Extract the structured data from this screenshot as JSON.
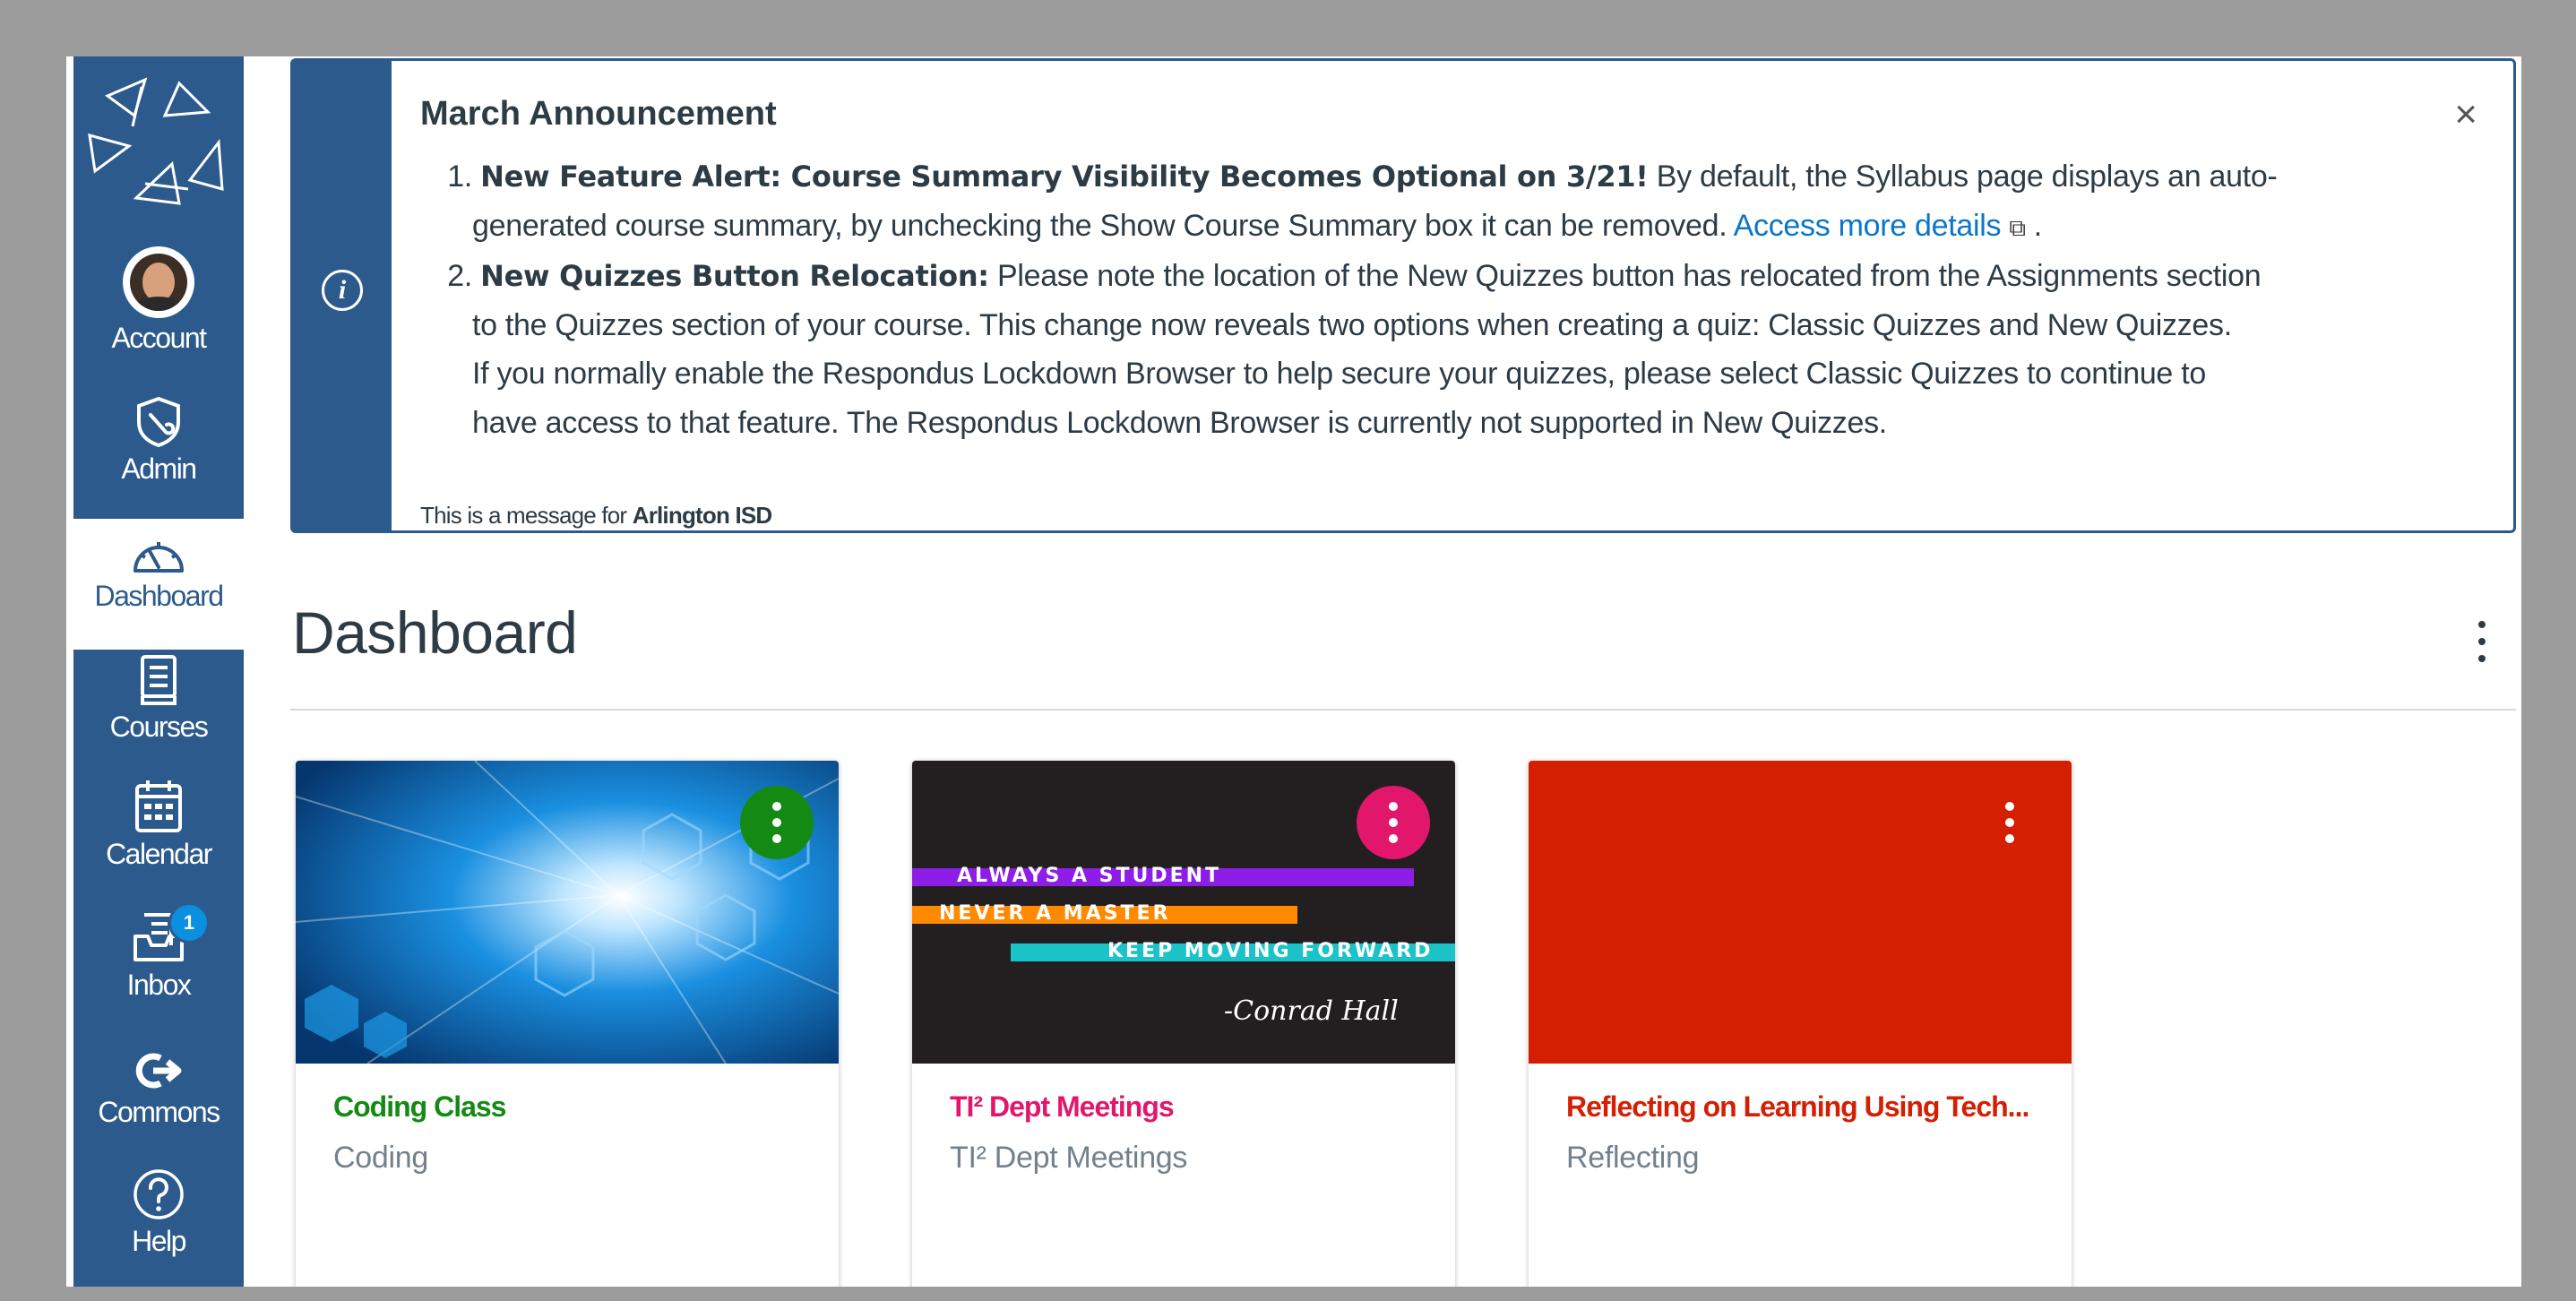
{
  "nav": {
    "items": [
      {
        "label": "Account",
        "icon": "avatar"
      },
      {
        "label": "Admin",
        "icon": "shield-icon"
      },
      {
        "label": "Dashboard",
        "icon": "speedometer-icon",
        "active": true
      },
      {
        "label": "Courses",
        "icon": "book-icon"
      },
      {
        "label": "Calendar",
        "icon": "calendar-icon"
      },
      {
        "label": "Inbox",
        "icon": "inbox-icon",
        "badge": "1"
      },
      {
        "label": "Commons",
        "icon": "commons-arrow-icon"
      },
      {
        "label": "Help",
        "icon": "question-circle-icon"
      }
    ],
    "colors": {
      "background": "#2d5a8c",
      "active_background": "#ffffff"
    }
  },
  "announcement": {
    "title": "March Announcement",
    "close_icon": "×",
    "info_icon": "i",
    "item1_number": "1.",
    "item1_bold": "New Feature Alert: Course Summary Visibility Becomes Optional on 3/21!",
    "item1_text_a": " By default, the Syllabus page displays an auto-",
    "item1_text_b": "generated course summary, by unchecking the Show Course Summary box it can be removed. ",
    "item1_link": "Access more details",
    "item1_link_icon": "⧉",
    "item1_end": " .",
    "item2_number": "2.",
    "item2_bold": "New Quizzes Button Relocation:",
    "item2_text_a": " Please note the location of the New Quizzes button has relocated from the Assignments section",
    "item2_text_b": "to the Quizzes section of your course. This change now reveals two options when creating a quiz: Classic Quizzes and New Quizzes.",
    "item2_text_c": "If you normally enable the Respondus Lockdown Browser to help secure your quizzes, please select Classic Quizzes to continue to",
    "item2_text_d": "have access to that feature. The Respondus Lockdown Browser is currently not supported in New Quizzes.",
    "footer_prefix": "This is a message for ",
    "footer_org": "Arlington ISD"
  },
  "dashboard": {
    "title": "Dashboard",
    "cards": [
      {
        "title": "Coding Class",
        "subtitle": "Coding",
        "color": "#138a13"
      },
      {
        "title": "TI² Dept Meetings",
        "subtitle": "TI² Dept Meetings",
        "color": "#e2176b",
        "hero_lines": [
          "ALWAYS A STUDENT",
          "NEVER A MASTER",
          "KEEP MOVING FORWARD"
        ],
        "hero_signature": "-Conrad Hall"
      },
      {
        "title": "Reflecting on Learning Using Tech...",
        "subtitle": "Reflecting",
        "color": "#d41f02"
      }
    ]
  }
}
